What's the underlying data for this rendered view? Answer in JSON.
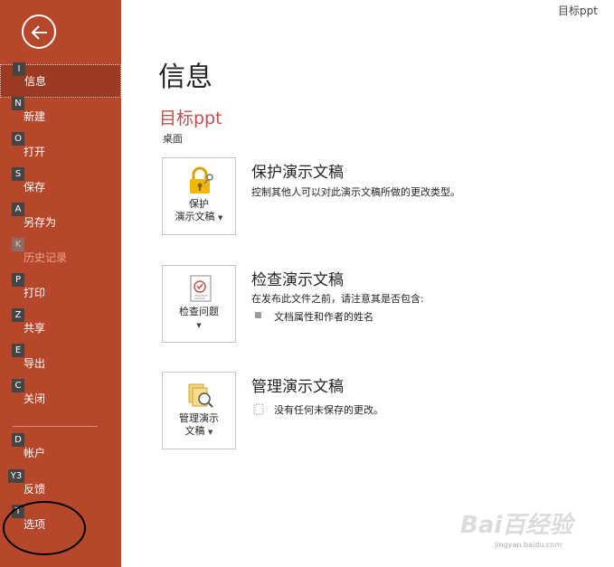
{
  "window": {
    "title": "目标ppt"
  },
  "sidebar": {
    "items": [
      {
        "key": "I",
        "label": "信息",
        "state": "active"
      },
      {
        "key": "N",
        "label": "新建",
        "state": "normal"
      },
      {
        "key": "O",
        "label": "打开",
        "state": "normal"
      },
      {
        "key": "S",
        "label": "保存",
        "state": "normal"
      },
      {
        "key": "A",
        "label": "另存为",
        "state": "normal"
      },
      {
        "key": "K",
        "label": "历史记录",
        "state": "disabled"
      },
      {
        "key": "P",
        "label": "打印",
        "state": "normal"
      },
      {
        "key": "Z",
        "label": "共享",
        "state": "normal"
      },
      {
        "key": "E",
        "label": "导出",
        "state": "normal"
      },
      {
        "key": "C",
        "label": "关闭",
        "state": "normal"
      },
      {
        "key": "D",
        "label": "帐户",
        "state": "normal"
      },
      {
        "key": "Y3",
        "label": "反馈",
        "state": "normal"
      },
      {
        "key": "T",
        "label": "选项",
        "state": "normal"
      }
    ]
  },
  "main": {
    "title": "信息",
    "doc_name": "目标ppt",
    "doc_location": "桌面",
    "sections": [
      {
        "tile_line1": "保护",
        "tile_line2": "演示文稿",
        "heading": "保护演示文稿",
        "desc": "控制其他人可以对此演示文稿所做的更改类型。"
      },
      {
        "tile_line1": "检查问题",
        "heading": "检查演示文稿",
        "desc": "在发布此文件之前，请注意其是否包含:",
        "bullet": "文档属性和作者的姓名"
      },
      {
        "tile_line1": "管理演示",
        "tile_line2": "文稿",
        "heading": "管理演示文稿",
        "note": "没有任何未保存的更改。"
      }
    ]
  },
  "watermark": {
    "text": "Bai百经验",
    "sub": "jingyan.baidu.com"
  },
  "colors": {
    "sidebar": "#b7472a",
    "accent": "#c0504d"
  }
}
